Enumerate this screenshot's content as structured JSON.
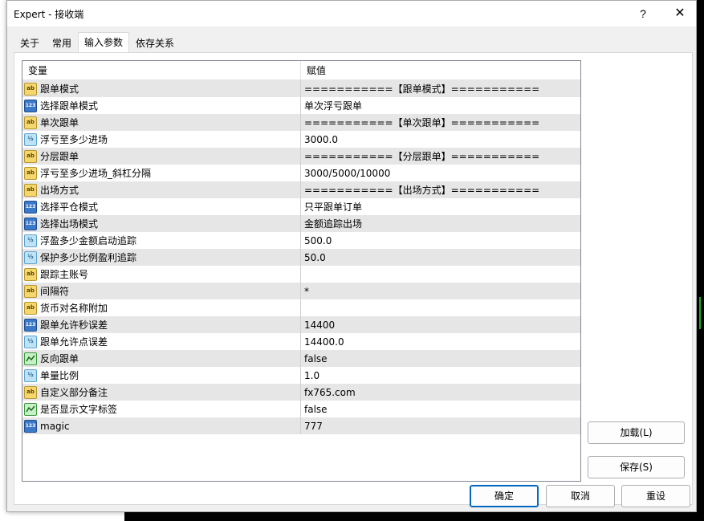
{
  "window": {
    "title": "Expert - 接收端",
    "help_glyph": "?",
    "close_glyph": "✕"
  },
  "tabs": [
    {
      "label": "关于"
    },
    {
      "label": "常用"
    },
    {
      "label": "输入参数",
      "active": true
    },
    {
      "label": "依存关系"
    }
  ],
  "grid": {
    "header": {
      "variable": "变量",
      "value": "赋值"
    },
    "rows": [
      {
        "icon": "ab",
        "name": "跟单模式",
        "value": "===========【跟单模式】==========="
      },
      {
        "icon": "123",
        "name": "选择跟单模式",
        "value": "单次浮亏跟单"
      },
      {
        "icon": "ab",
        "name": "单次跟单",
        "value": "===========【单次跟单】==========="
      },
      {
        "icon": "v2",
        "name": "浮亏至多少进场",
        "value": "3000.0"
      },
      {
        "icon": "ab",
        "name": "分层跟单",
        "value": "===========【分层跟单】==========="
      },
      {
        "icon": "ab",
        "name": "浮亏至多少进场_斜杠分隔",
        "value": "3000/5000/10000"
      },
      {
        "icon": "ab",
        "name": "出场方式",
        "value": "===========【出场方式】==========="
      },
      {
        "icon": "123",
        "name": "选择平仓模式",
        "value": "只平跟单订单"
      },
      {
        "icon": "123",
        "name": "选择出场模式",
        "value": "金额追踪出场"
      },
      {
        "icon": "v2",
        "name": "浮盈多少金额启动追踪",
        "value": "500.0"
      },
      {
        "icon": "v2",
        "name": "保护多少比例盈利追踪",
        "value": "50.0"
      },
      {
        "icon": "ab",
        "name": "跟踪主账号",
        "value": ""
      },
      {
        "icon": "ab",
        "name": "间隔符",
        "value": "*"
      },
      {
        "icon": "ab",
        "name": "货币对名称附加",
        "value": ""
      },
      {
        "icon": "123",
        "name": "跟单允许秒误差",
        "value": "14400"
      },
      {
        "icon": "v2",
        "name": "跟单允许点误差",
        "value": "14400.0"
      },
      {
        "icon": "bool",
        "name": "反向跟单",
        "value": "false"
      },
      {
        "icon": "v2",
        "name": "单量比例",
        "value": "1.0"
      },
      {
        "icon": "ab",
        "name": "自定义部分备注",
        "value": "fx765.com"
      },
      {
        "icon": "bool",
        "name": "是否显示文字标签",
        "value": "false"
      },
      {
        "icon": "123",
        "name": "magic",
        "value": "777"
      }
    ]
  },
  "side_buttons": {
    "load": "加载(L)",
    "save": "保存(S)"
  },
  "bottom_buttons": {
    "ok": "确定",
    "cancel": "取消",
    "reset": "重设"
  },
  "icon_texts": {
    "ab": "ab",
    "123": "123",
    "v2": "½"
  }
}
